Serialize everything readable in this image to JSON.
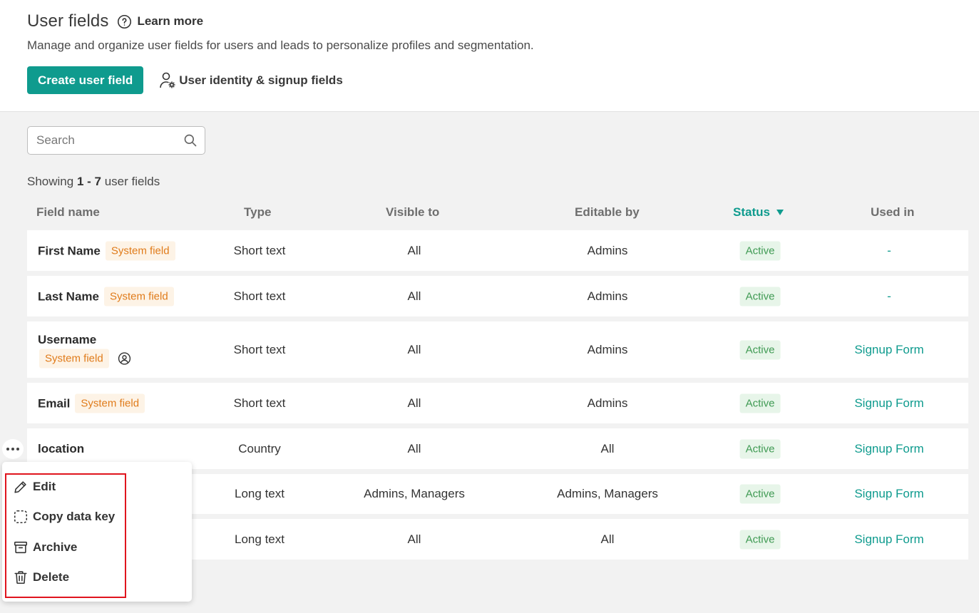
{
  "header": {
    "title": "User fields",
    "learn_more": "Learn more",
    "subtitle": "Manage and organize user fields for users and leads to personalize profiles and segmentation.",
    "create_button": "Create user field",
    "identity_link": "User identity & signup fields"
  },
  "search": {
    "placeholder": "Search"
  },
  "showing": {
    "prefix": "Showing",
    "range": "1 - 7",
    "suffix": "user fields"
  },
  "columns": {
    "field_name": "Field name",
    "type": "Type",
    "visible_to": "Visible to",
    "editable_by": "Editable by",
    "status": "Status",
    "used_in": "Used in"
  },
  "rows": [
    {
      "name": "First Name",
      "badge": "System field",
      "type": "Short text",
      "visible_to": "All",
      "editable_by": "Admins",
      "status": "Active",
      "used_in": "-"
    },
    {
      "name": "Last Name",
      "badge": "System field",
      "type": "Short text",
      "visible_to": "All",
      "editable_by": "Admins",
      "status": "Active",
      "used_in": "-"
    },
    {
      "name": "Username",
      "badge": "System field",
      "type": "Short text",
      "visible_to": "All",
      "editable_by": "Admins",
      "status": "Active",
      "used_in": "Signup Form"
    },
    {
      "name": "Email",
      "badge": "System field",
      "type": "Short text",
      "visible_to": "All",
      "editable_by": "Admins",
      "status": "Active",
      "used_in": "Signup Form"
    },
    {
      "name": "location",
      "type": "Country",
      "visible_to": "All",
      "editable_by": "All",
      "status": "Active",
      "used_in": "Signup Form"
    },
    {
      "type": "Long text",
      "visible_to": "Admins, Managers",
      "editable_by": "Admins, Managers",
      "status": "Active",
      "used_in": "Signup Form"
    },
    {
      "type": "Long text",
      "visible_to": "All",
      "editable_by": "All",
      "status": "Active",
      "used_in": "Signup Form"
    }
  ],
  "context_menu": {
    "items": [
      "Edit",
      "Copy data key",
      "Archive",
      "Delete"
    ]
  },
  "colors": {
    "accent": "#0f9b8e",
    "system_badge_bg": "#fdf3e6",
    "system_badge_text": "#e07b1a",
    "active_badge_bg": "#e7f5e9",
    "active_badge_text": "#3f9a53",
    "highlight_border": "#e0141e"
  }
}
